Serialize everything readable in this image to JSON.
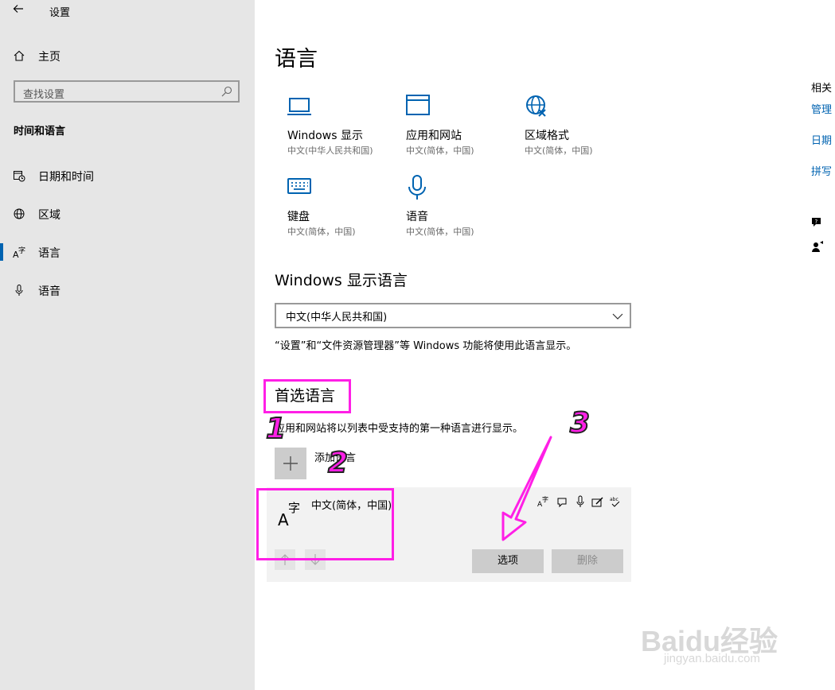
{
  "window": {
    "title": "设置"
  },
  "sidebar": {
    "home": "主页",
    "search_placeholder": "查找设置",
    "section": "时间和语言",
    "items": [
      {
        "label": "日期和时间",
        "icon": "clock-calendar-icon"
      },
      {
        "label": "区域",
        "icon": "globe-icon"
      },
      {
        "label": "语言",
        "icon": "language-icon",
        "selected": true
      },
      {
        "label": "语音",
        "icon": "microphone-icon"
      }
    ]
  },
  "main": {
    "title": "语言",
    "tiles": [
      {
        "name": "Windows 显示",
        "sub": "中文(中华人民共和国)",
        "icon": "monitor-icon"
      },
      {
        "name": "应用和网站",
        "sub": "中文(简体，中国)",
        "icon": "window-icon"
      },
      {
        "name": "区域格式",
        "sub": "中文(简体，中国)",
        "icon": "region-format-icon"
      },
      {
        "name": "键盘",
        "sub": "中文(简体，中国)",
        "icon": "keyboard-icon"
      },
      {
        "name": "语音",
        "sub": "中文(简体，中国)",
        "icon": "microphone-icon"
      }
    ],
    "display_language": {
      "heading": "Windows 显示语言",
      "value": "中文(中华人民共和国)",
      "note": "“设置”和“文件资源管理器”等 Windows 功能将使用此语言显示。"
    },
    "preferred": {
      "heading": "首选语言",
      "description": "应用和网站将以列表中受支持的第一种语言进行显示。",
      "add_label": "添加语言",
      "language": "中文(简体，中国)",
      "options_button": "选项",
      "remove_button": "删除"
    }
  },
  "related": {
    "heading": "相关",
    "links": [
      "管理",
      "日期",
      "拼写"
    ]
  },
  "annotations": {
    "n1": "1",
    "n2": "2",
    "n3": "3",
    "color": "#ff1fe6"
  },
  "watermark": {
    "brand": "Baidu经验",
    "url": "jingyan.baidu.com"
  },
  "colors": {
    "accent": "#0063b1",
    "sidebar_bg": "#e6e6e6",
    "card_bg": "#f2f2f2"
  }
}
